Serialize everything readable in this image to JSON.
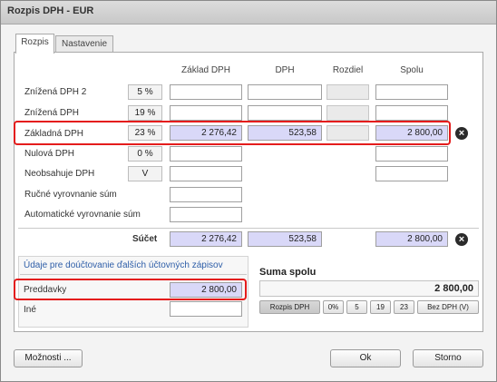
{
  "window": {
    "title": "Rozpis DPH - EUR"
  },
  "tabs": [
    {
      "label": "Rozpis",
      "active": true
    },
    {
      "label": "Nastavenie",
      "active": false
    }
  ],
  "columns": {
    "base": "Základ DPH",
    "vat": "DPH",
    "diff": "Rozdiel",
    "total": "Spolu"
  },
  "rows": [
    {
      "label": "Znížená DPH 2",
      "rate": "5 %",
      "base": "",
      "vat": "",
      "diff": "",
      "total": ""
    },
    {
      "label": "Znížená DPH",
      "rate": "19 %",
      "base": "",
      "vat": "",
      "diff": "",
      "total": ""
    },
    {
      "label": "Základná DPH",
      "rate": "23 %",
      "base": "2 276,42",
      "vat": "523,58",
      "diff": "",
      "total": "2 800,00"
    },
    {
      "label": "Nulová DPH",
      "rate": "0 %",
      "base": "",
      "total": ""
    },
    {
      "label": "Neobsahuje DPH",
      "rate": "V",
      "base": "",
      "total": ""
    },
    {
      "label": "Ručné vyrovnanie súm",
      "base": ""
    },
    {
      "label": "Automatické vyrovnanie súm",
      "base": ""
    }
  ],
  "sum": {
    "label": "Súčet",
    "base": "2 276,42",
    "vat": "523,58",
    "total": "2 800,00"
  },
  "extra": {
    "title": "Údaje pre doúčtovanie ďalších účtovných zápisov",
    "advances_label": "Preddavky",
    "advances_value": "2 800,00",
    "other_label": "Iné",
    "other_value": ""
  },
  "suma": {
    "title": "Suma spolu",
    "value": "2 800,00",
    "buttons": [
      "Rozpis DPH",
      "0%",
      "5",
      "19",
      "23",
      "Bez DPH (V)"
    ]
  },
  "footer": {
    "options": "Možnosti ...",
    "ok": "Ok",
    "cancel": "Storno"
  },
  "colors": {
    "highlight": "#e41c1c",
    "filled_field": "#d9d8f8"
  }
}
